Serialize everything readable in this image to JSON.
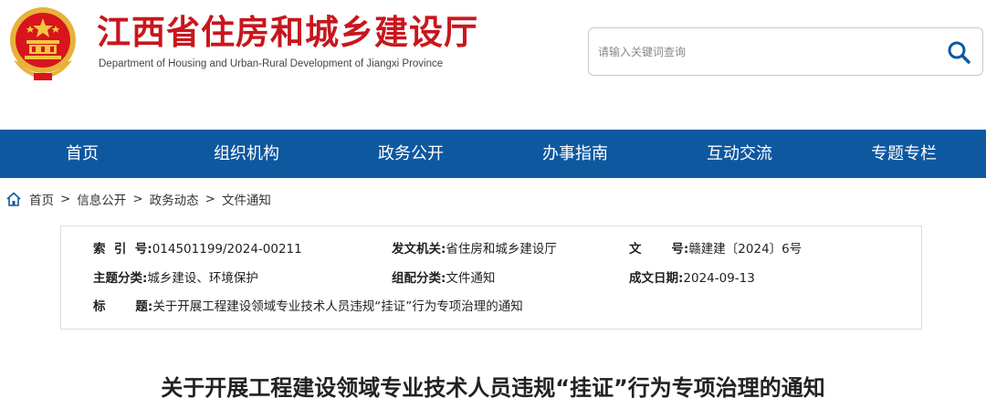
{
  "header": {
    "title": "江西省住房和城乡建设厅",
    "subtitle": "Department of Housing and Urban-Rural Development of Jiangxi Province",
    "emblem_icon": "national-emblem-icon",
    "brand_color": "#c8161d"
  },
  "search": {
    "placeholder": "请输入关键词查询",
    "button_icon": "search-icon",
    "icon_color": "#0e58a0"
  },
  "nav": {
    "color": "#0e58a0",
    "items": [
      {
        "label": "首页"
      },
      {
        "label": "组织机构"
      },
      {
        "label": "政务公开"
      },
      {
        "label": "办事指南"
      },
      {
        "label": "互动交流"
      },
      {
        "label": "专题专栏"
      }
    ]
  },
  "breadcrumb": {
    "home_icon": "home-icon",
    "items": [
      "首页",
      "信息公开",
      "政务动态",
      "文件通知"
    ],
    "separator": ">"
  },
  "meta": {
    "index_label": "索  引  号:",
    "index_value": "014501199/2024-00211",
    "issuer_label": "发文机关:",
    "issuer_value": "省住房和城乡建设厅",
    "docno_label": "文       号:",
    "docno_value": "赣建建〔2024〕6号",
    "topic_label": "主题分类:",
    "topic_value": "城乡建设、环境保护",
    "category_label": "组配分类:",
    "category_value": "文件通知",
    "date_label": "成文日期:",
    "date_value": "2024-09-13",
    "title_label": "标       题:",
    "title_value": "关于开展工程建设领域专业技术人员违规“挂证”行为专项治理的通知"
  },
  "article": {
    "title": "关于开展工程建设领域专业技术人员违规“挂证”行为专项治理的通知"
  }
}
